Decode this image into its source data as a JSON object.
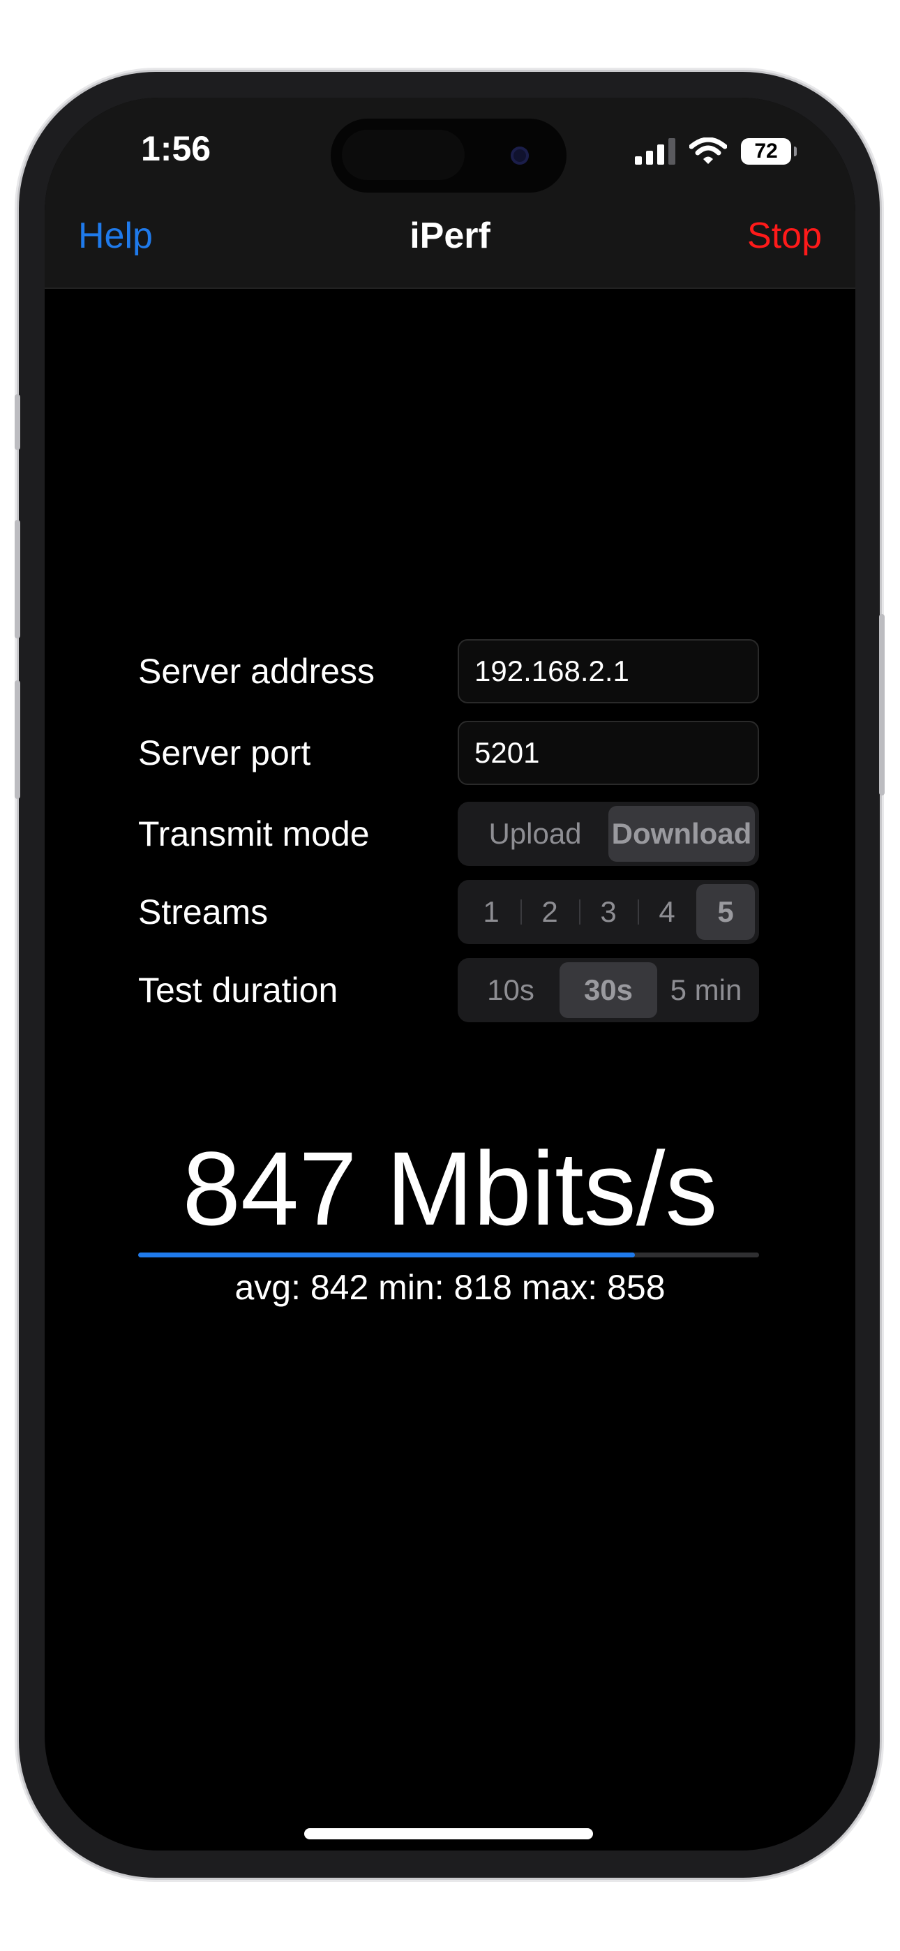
{
  "status_bar": {
    "time": "1:56",
    "battery": "72",
    "icons": [
      "cellular-signal-icon",
      "wifi-icon",
      "battery-icon"
    ]
  },
  "navbar": {
    "left_button": "Help",
    "title": "iPerf",
    "right_button": "Stop"
  },
  "form": {
    "server_address": {
      "label": "Server address",
      "value": "192.168.2.1"
    },
    "server_port": {
      "label": "Server port",
      "value": "5201"
    },
    "transmit_mode": {
      "label": "Transmit mode",
      "options": [
        "Upload",
        "Download"
      ],
      "selected": "Download"
    },
    "streams": {
      "label": "Streams",
      "options": [
        "1",
        "2",
        "3",
        "4",
        "5"
      ],
      "selected": "5"
    },
    "test_duration": {
      "label": "Test duration",
      "options": [
        "10s",
        "30s",
        "5 min"
      ],
      "selected": "30s"
    }
  },
  "result": {
    "throughput": "847 Mbits/s",
    "progress": 0.8,
    "stats": "avg: 842 min: 818 max: 858"
  },
  "colors": {
    "accent": "#1f7aeb",
    "stop": "#ff1a1a",
    "background": "#000000",
    "navbar": "#161616"
  }
}
